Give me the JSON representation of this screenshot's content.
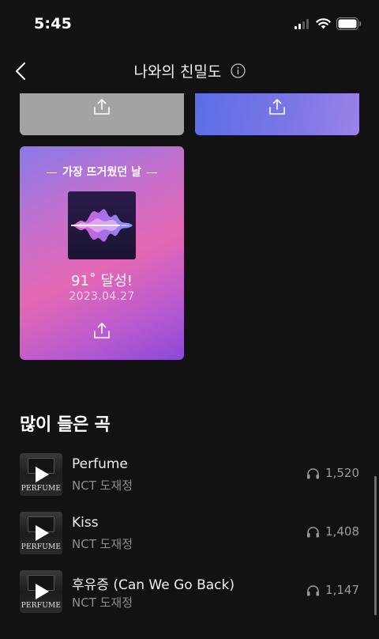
{
  "status_bar": {
    "time": "5:45"
  },
  "header": {
    "title": "나와의 친밀도"
  },
  "cards": {
    "hot_day": {
      "label": "가장 뜨거웠던 날",
      "temperature": "91˚ 달성!",
      "date": "2023.04.27"
    }
  },
  "most_played": {
    "title": "많이 들은 곡",
    "songs": [
      {
        "title": "Perfume",
        "artist": "NCT 도재정",
        "plays": "1,520",
        "album_text": "PERFUME"
      },
      {
        "title": "Kiss",
        "artist": "NCT 도재정",
        "plays": "1,408",
        "album_text": "PERFUME"
      },
      {
        "title": "후유증 (Can We Go Back)",
        "artist": "NCT 도재정",
        "plays": "1,147",
        "album_text": "PERFUME"
      }
    ]
  },
  "colors": {
    "background": "#121212",
    "card_gray": "#a3a3a3",
    "card_blue": "#6a72e6",
    "card_hot_pink": "#e468b4",
    "card_hot_purple": "#8b48d8"
  },
  "icons": [
    "back-icon",
    "info-icon",
    "share-icon",
    "play-icon",
    "headphone-icon",
    "signal-icon",
    "wifi-icon",
    "battery-icon"
  ]
}
